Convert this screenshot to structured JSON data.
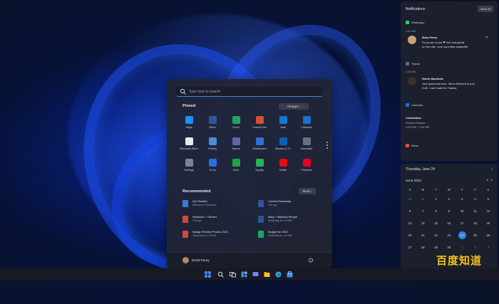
{
  "start_menu": {
    "search_placeholder": "Type here to search",
    "pinned_title": "Pinned",
    "all_apps_label": "All apps  ›",
    "pinned_apps": [
      {
        "label": "Edge",
        "color": "#1f8ef1"
      },
      {
        "label": "Word",
        "color": "#2b579a"
      },
      {
        "label": "Excel",
        "color": "#21a366"
      },
      {
        "label": "PowerPoint",
        "color": "#d35230"
      },
      {
        "label": "Mail",
        "color": "#0f78d4"
      },
      {
        "label": "Calendar",
        "color": "#1d6fd1"
      },
      {
        "label": "Microsoft Store",
        "color": "#e9e9e9"
      },
      {
        "label": "Photos",
        "color": "#4e8ad8"
      },
      {
        "label": "Teams",
        "color": "#6264a7"
      },
      {
        "label": "Whiteboard",
        "color": "#2f6fd6"
      },
      {
        "label": "Movies & TV",
        "color": "#0f5fb8"
      },
      {
        "label": "Calculator",
        "color": "#6b6f7d"
      },
      {
        "label": "Settings",
        "color": "#7b8599"
      },
      {
        "label": "To Do",
        "color": "#2b6fe3"
      },
      {
        "label": "Xbox",
        "color": "#1da548"
      },
      {
        "label": "Spotify",
        "color": "#1db954"
      },
      {
        "label": "Netflix",
        "color": "#e50914"
      },
      {
        "label": "Pinterest",
        "color": "#e60023"
      }
    ],
    "recommended_title": "Recommended",
    "more_label": "More  ›",
    "recommended": [
      {
        "title": "Get Started",
        "subtitle": "Welcome to Windows",
        "color": "#3a7bd5"
      },
      {
        "title": "Content Roadmap",
        "subtitle": "13h ago",
        "color": "#2b579a"
      },
      {
        "title": "Windows + Thinker",
        "subtitle": "12h ago",
        "color": "#d04a3a"
      },
      {
        "title": "Mary + Barbara Recipe",
        "subtitle": "Yesterday at 1:15 PM",
        "color": "#2b579a"
      },
      {
        "title": "Design Review Photos 2021",
        "subtitle": "Yesterday at 1:15 PM",
        "color": "#d04a3a"
      },
      {
        "title": "Budget for 2021",
        "subtitle": "Yesterday at 1:15 PM",
        "color": "#21a366"
      }
    ],
    "user_name": "Devid Parey",
    "power_icon": "power-icon"
  },
  "notifications": {
    "title": "Notifications",
    "clear_all": "Clear all",
    "groups": [
      {
        "app": "WhatsApp",
        "app_color": "#25d366",
        "time": "1:00 AM",
        "sender": "Mary Parey",
        "lines": [
          "So proud of you ❤ You look great",
          "on the call. Love your fake spaghetti"
        ],
        "avatar_color": "#caa27a"
      },
      {
        "app": "Teams",
        "app_color": "#6264a7",
        "time": "1:00 AM",
        "sender": "Stevie Bariholie",
        "lines": [
          "Just spent last hour. We're finished to pull",
          "it off. I can't wait for Thanks"
        ],
        "avatar_color": "#3b2f2a"
      },
      {
        "app": "Calendar",
        "app_color": "#1d6fd1",
        "time": "",
        "sender": "Celebration",
        "lines": [
          "Fitness Planner",
          "2:00 PM - 3:00 PM"
        ],
        "avatar_color": ""
      }
    ],
    "news_app": "News"
  },
  "calendar": {
    "day_label": "Thursday, June 24",
    "month_label": "June 2021",
    "weekdays": [
      "S",
      "M",
      "T",
      "W",
      "T",
      "F",
      "S"
    ],
    "weeks": [
      [
        "30",
        "31",
        "1",
        "2",
        "3",
        "4",
        "5"
      ],
      [
        "6",
        "7",
        "8",
        "9",
        "10",
        "11",
        "12"
      ],
      [
        "13",
        "14",
        "15",
        "16",
        "17",
        "18",
        "19"
      ],
      [
        "20",
        "21",
        "22",
        "23",
        "24",
        "25",
        "26"
      ],
      [
        "27",
        "28",
        "29",
        "30",
        "1",
        "2",
        "3"
      ]
    ],
    "today": "24"
  },
  "watermark": "百度知道",
  "taskbar_icons": [
    "windows-icon",
    "search-icon",
    "task-view-icon",
    "widgets-icon",
    "chat-icon",
    "file-explorer-icon",
    "edge-icon",
    "store-icon"
  ]
}
